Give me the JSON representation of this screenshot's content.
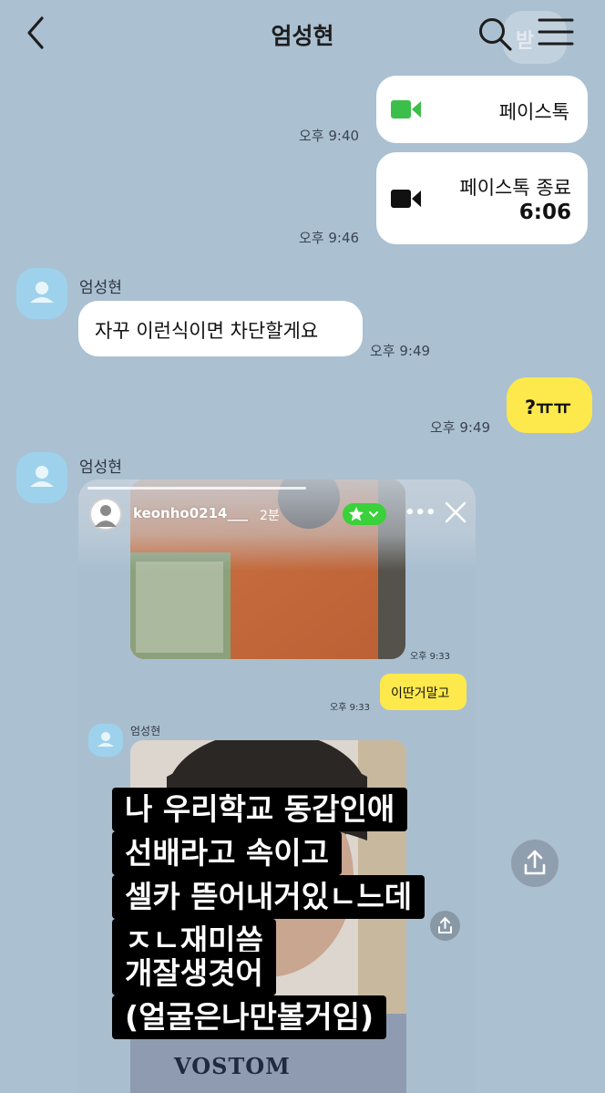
{
  "header": {
    "title": "엄성현",
    "ghost_label": "받"
  },
  "messages": {
    "facetime1": {
      "label": "페이스톡",
      "time": "오후 9:40",
      "icon": "video-camera-icon",
      "icon_color": "#3cbf4a"
    },
    "facetime2": {
      "label": "페이스톡 종료",
      "duration": "6:06",
      "time": "오후 9:46",
      "icon": "video-camera-icon"
    },
    "received1": {
      "sender": "엄성현",
      "text": "자꾸 이런식이면 차단할게요",
      "time": "오후 9:49"
    },
    "sent1": {
      "text": "?ㅠㅠ",
      "time": "오후 9:49"
    },
    "received2": {
      "sender": "엄성현"
    }
  },
  "embedded": {
    "story": {
      "username": "keonho0214___",
      "age": "2분"
    },
    "story_time": "오후 9:33",
    "sent_msg": {
      "text": "이딴거말고",
      "time": "오후 9:33"
    },
    "sender": "엄성현",
    "caption_lines": [
      "나 우리학교 동갑인애",
      "선배라고 속이고",
      "셀카 뜯어내거있ㄴ느데",
      "ㅈㄴ재미씀",
      "개잘생겻어",
      "(얼굴은나만볼거임)"
    ],
    "shirt_text": "VOSTOM"
  },
  "colors": {
    "background": "#abc0d1",
    "my_bubble": "#fde94c",
    "their_bubble": "#ffffff",
    "avatar": "#9ed2ec",
    "facetime_green": "#3cbf4a"
  }
}
